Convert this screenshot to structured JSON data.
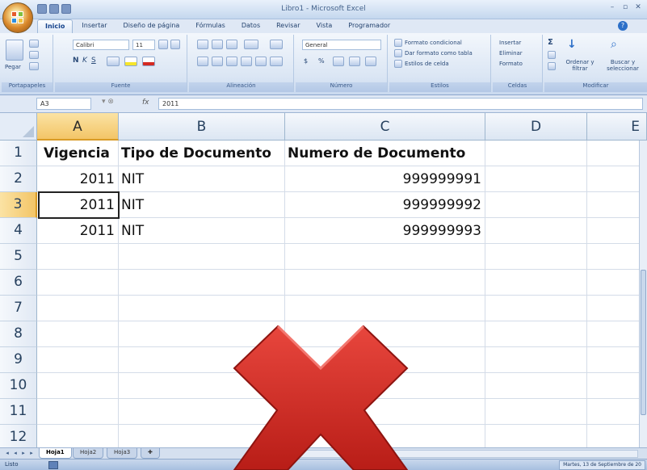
{
  "window": {
    "title": "Libro1 - Microsoft Excel"
  },
  "ribbon": {
    "tabs": [
      {
        "label": "Inicio",
        "active": true
      },
      {
        "label": "Insertar",
        "active": false
      },
      {
        "label": "Diseño de página",
        "active": false
      },
      {
        "label": "Fórmulas",
        "active": false
      },
      {
        "label": "Datos",
        "active": false
      },
      {
        "label": "Revisar",
        "active": false
      },
      {
        "label": "Vista",
        "active": false
      },
      {
        "label": "Programador",
        "active": false
      }
    ],
    "clipboard": {
      "paste_label": "Pegar",
      "group_label": "Portapapeles"
    },
    "font": {
      "family": "Calibri",
      "size": "11",
      "group_label": "Fuente"
    },
    "alignment": {
      "group_label": "Alineación"
    },
    "number": {
      "format": "General",
      "group_label": "Número"
    },
    "styles": {
      "conditional": "Formato condicional",
      "as_table": "Dar formato como tabla",
      "cell_styles": "Estilos de celda",
      "group_label": "Estilos"
    },
    "cells": {
      "insert": "Insertar",
      "delete": "Eliminar",
      "format": "Formato",
      "group_label": "Celdas"
    },
    "editing": {
      "sort": "Ordenar y filtrar",
      "find": "Buscar y seleccionar",
      "group_label": "Modificar"
    }
  },
  "formula_bar": {
    "name_box": "A3",
    "fx": "fx",
    "content": "2011"
  },
  "grid": {
    "columns": [
      "A",
      "B",
      "C",
      "D",
      "E"
    ],
    "selected_column": "A",
    "rows": [
      "1",
      "2",
      "3",
      "4",
      "5",
      "6",
      "7",
      "8",
      "9",
      "10",
      "11",
      "12"
    ],
    "selected_row": "3",
    "cells": {
      "A1": "Vigencia",
      "B1": "Tipo de Documento",
      "C1": "Numero de Documento",
      "A2": "2011",
      "B2": "NIT",
      "C2": "999999991",
      "A3": "2011",
      "B3": "NIT",
      "C3": "999999992",
      "A4": "2011",
      "B4": "NIT",
      "C4": "999999993"
    }
  },
  "sheets": [
    {
      "label": "Hoja1",
      "active": true
    },
    {
      "label": "Hoja2",
      "active": false
    },
    {
      "label": "Hoja3",
      "active": false
    }
  ],
  "status": {
    "mode": "Listo",
    "right_text": "Martes, 13 de Septiembre de 20"
  },
  "colors": {
    "x_mark": "#d42a22",
    "selected_header": "#f3c567"
  }
}
